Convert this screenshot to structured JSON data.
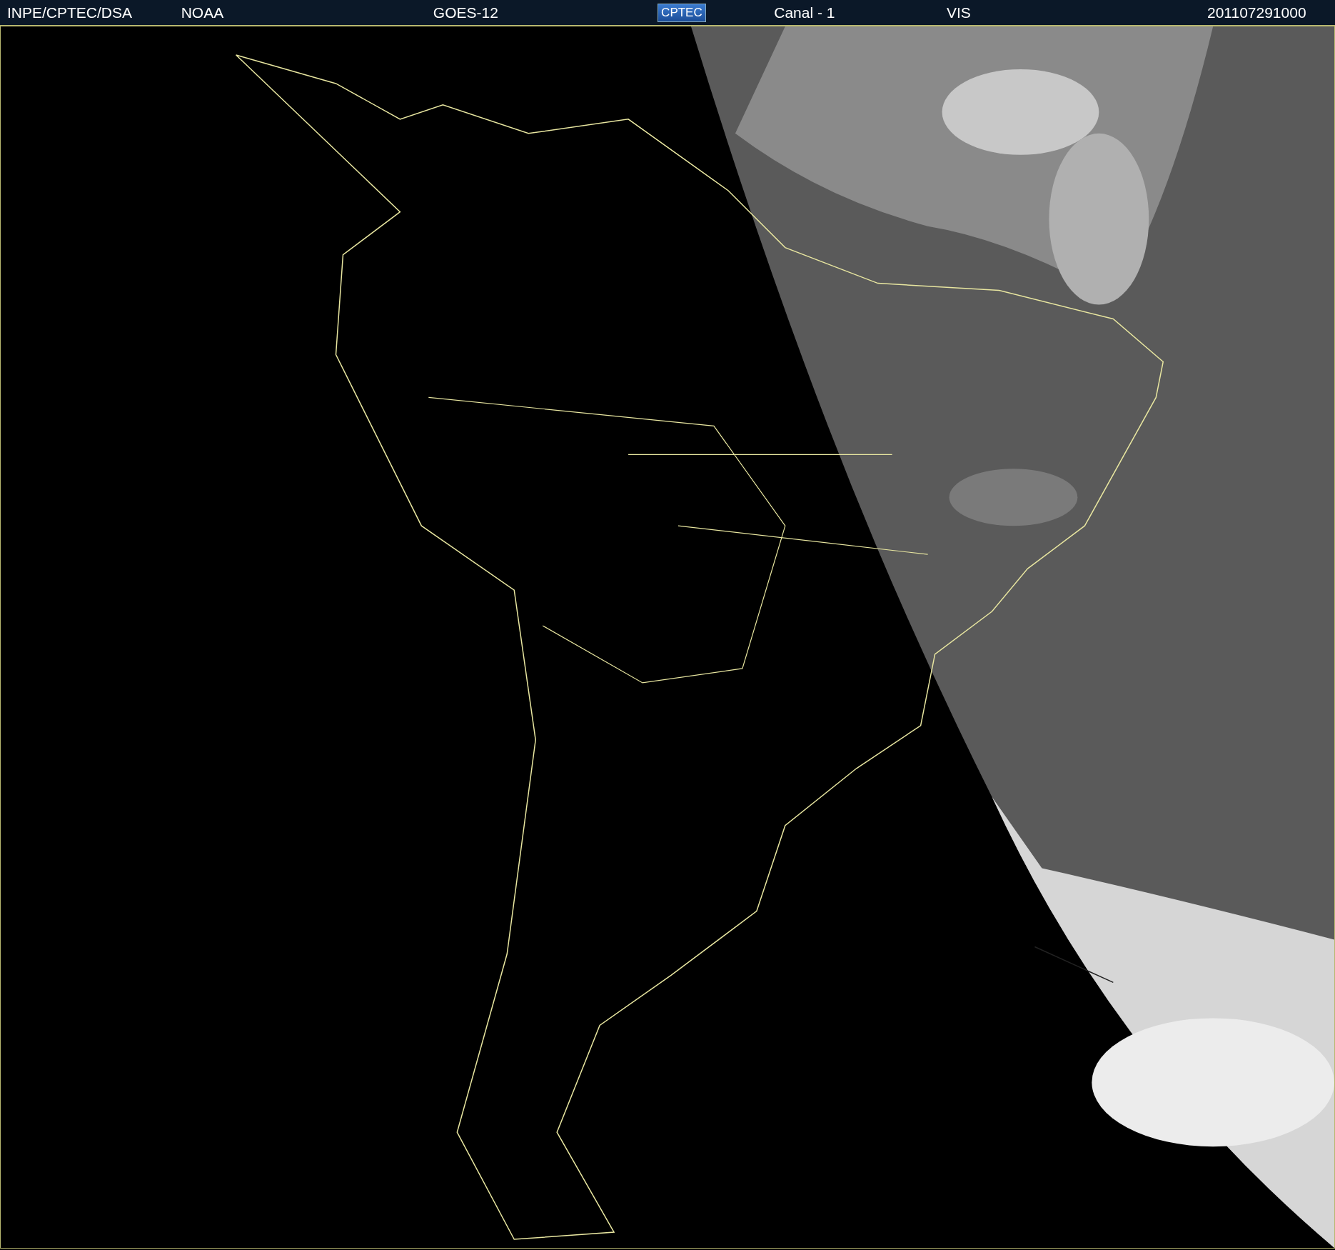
{
  "header": {
    "items": [
      {
        "kind": "text",
        "text": "INPE/CPTEC/DSA"
      },
      {
        "kind": "text",
        "text": "NOAA"
      },
      {
        "kind": "text",
        "text": "GOES-12"
      },
      {
        "kind": "logo",
        "text": "CPTEC"
      },
      {
        "kind": "text",
        "text": "Canal - 1"
      },
      {
        "kind": "text",
        "text": "VIS"
      },
      {
        "kind": "text",
        "text": "201107291000"
      }
    ]
  }
}
